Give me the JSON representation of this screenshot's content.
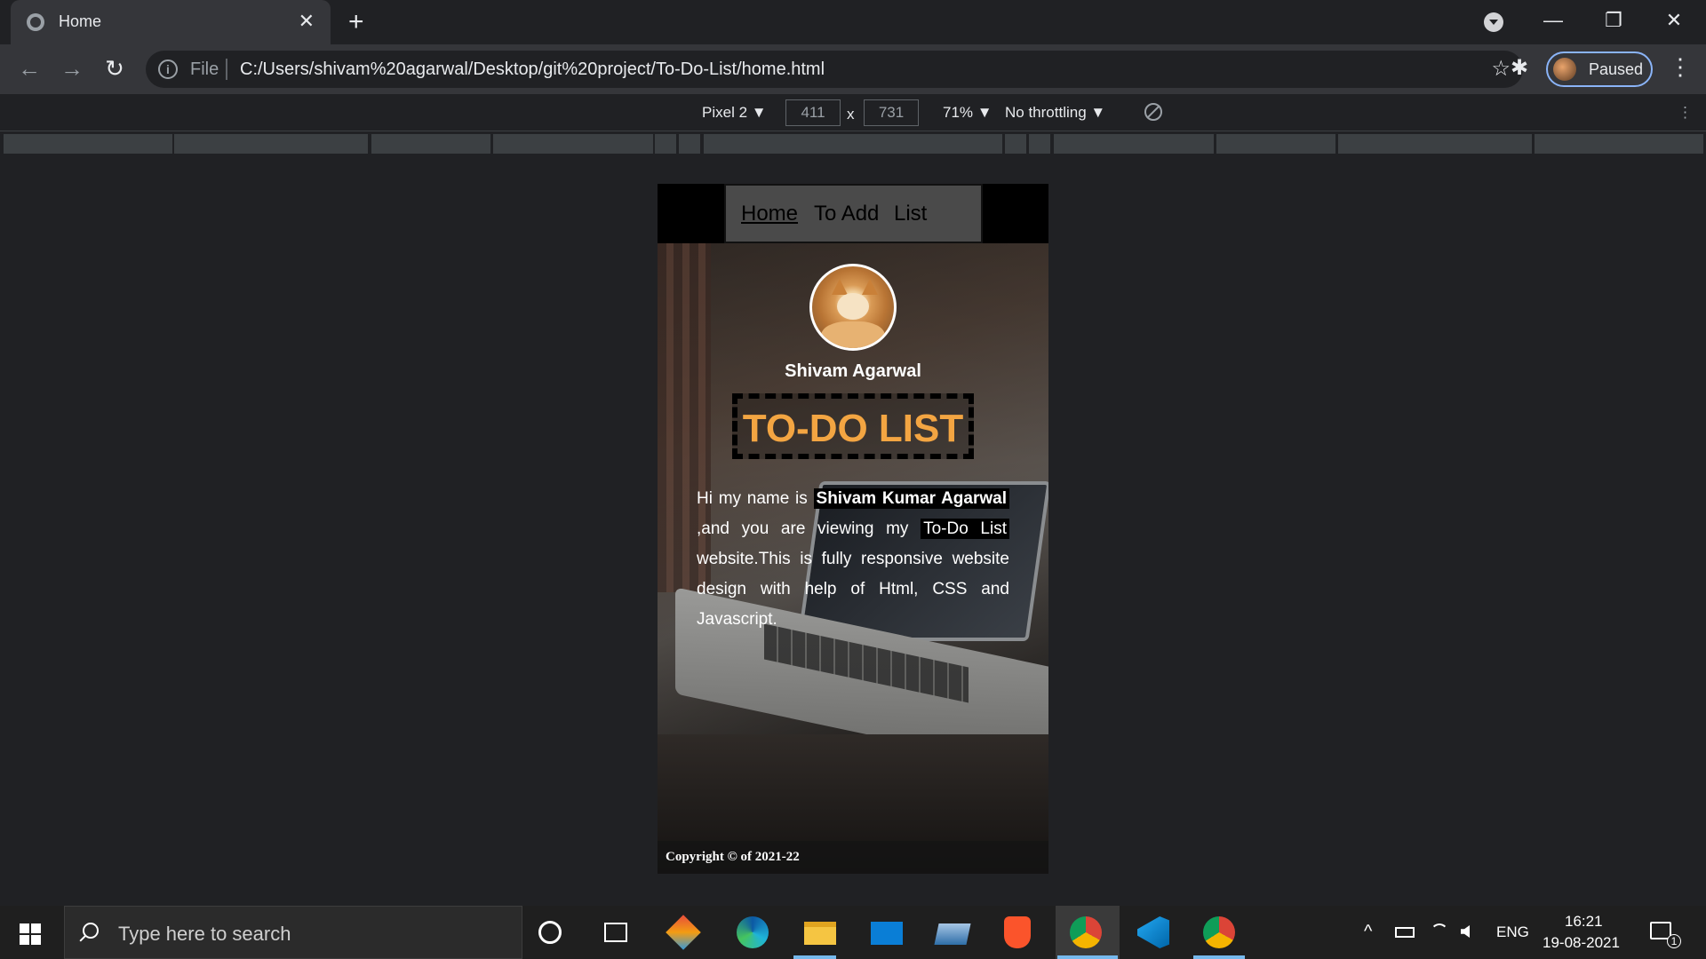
{
  "browser": {
    "tab_title": "Home",
    "tab_close": "✕",
    "new_tab": "+",
    "window_controls": {
      "minimize": "—",
      "restore": "❐",
      "close": "✕"
    },
    "nav": {
      "back": "←",
      "forward": "→",
      "reload": "↻"
    },
    "omnibox": {
      "info": "i",
      "scheme": "File",
      "url": "C:/Users/shivam%20agarwal/Desktop/git%20project/To-Do-List/home.html",
      "bookmark": "☆"
    },
    "extensions": "✱",
    "profile_status": "Paused",
    "menu": "⋮"
  },
  "device_toolbar": {
    "device": "Pixel 2 ▼",
    "width": "411",
    "times": "x",
    "height": "731",
    "zoom": "71% ▼",
    "throttling": "No throttling ▼",
    "menu": "⋮"
  },
  "page": {
    "nav": {
      "home": "Home",
      "to_add": "To Add",
      "list": "List"
    },
    "user_name": "Shivam Agarwal",
    "title": "TO-DO LIST",
    "intro": {
      "part1": "Hi my name is ",
      "name": "Shivam Kumar Agarwal",
      "part2": " ,and you are viewing my ",
      "site": "To-Do List",
      "part3": " website.This is fully responsive website design with help of Html, CSS and Javascript."
    },
    "footer": "Copyright © of 2021-22"
  },
  "taskbar": {
    "search_placeholder": "Type here to search",
    "language": "ENG",
    "time": "16:21",
    "date": "19-08-2021",
    "notification_count": "1",
    "tray_up": "^"
  },
  "colors": {
    "title_accent": "#f3a542",
    "nav_bg": "#4a4a4a",
    "chrome_dark": "#202124",
    "chrome_toolbar": "#35363a",
    "taskbar": "#1f1f1f"
  }
}
